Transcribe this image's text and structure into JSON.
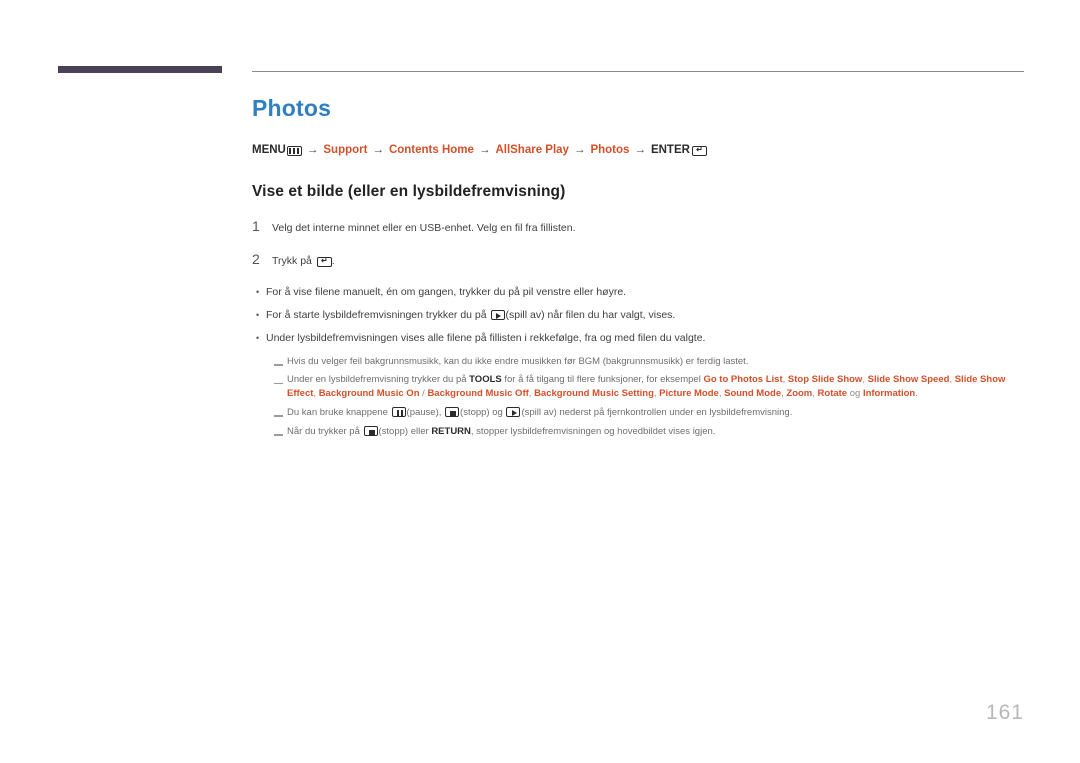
{
  "page": {
    "number": "161"
  },
  "title": "Photos",
  "breadcrumb": {
    "menu_label": "MENU",
    "menu_icon": "menu-grid-icon",
    "arrow": "→",
    "items": [
      {
        "label": "Support",
        "accent": true
      },
      {
        "label": "Contents Home",
        "accent": true
      },
      {
        "label": "AllShare Play",
        "accent": true
      },
      {
        "label": "Photos",
        "accent": true
      }
    ],
    "enter_label": "ENTER",
    "enter_icon": "enter-return-icon"
  },
  "section": {
    "heading": "Vise et bilde (eller en lysbildefremvisning)"
  },
  "steps": [
    {
      "num": "1",
      "text": "Velg det interne minnet eller en USB-enhet. Velg en fil fra fillisten."
    },
    {
      "num": "2",
      "text_before": "Trykk på ",
      "icon": "enter-return-icon",
      "text_after": "."
    }
  ],
  "bullets": [
    {
      "marker": "•",
      "text": "For å vise filene manuelt, én om gangen, trykker du på pil venstre eller høyre."
    },
    {
      "marker": "•",
      "text_before": "For å starte lysbildefremvisningen trykker du på ",
      "icon": "play-button-icon",
      "text_after": "(spill av) når filen du har valgt, vises."
    },
    {
      "marker": "•",
      "text": "Under lysbildefremvisningen vises alle filene på fillisten i rekkefølge, fra og med filen du valgte."
    }
  ],
  "notes": [
    {
      "text": "Hvis du velger feil bakgrunnsmusikk, kan du ikke endre musikken før BGM (bakgrunnsmusikk) er ferdig lastet."
    },
    {
      "part1": "Under en lysbildefremvisning trykker du på ",
      "bold1": "TOOLS",
      "part2": " for å få tilgang til flere funksjoner, for eksempel ",
      "options": [
        "Go to Photos List",
        "Stop Slide Show",
        "Slide Show Speed",
        "Slide Show Effect",
        "Background Music On",
        "Background Music Off",
        "Background Music Setting",
        "Picture Mode",
        "Sound Mode",
        "Zoom",
        "Rotate",
        "Information"
      ],
      "separator_slash": " / ",
      "separator_comma": ", ",
      "conjunction": " og ",
      "terminator": "."
    },
    {
      "part1": "Du kan bruke knappene ",
      "icon1": "pause-button-icon",
      "part2": "(pause), ",
      "icon2": "stop-button-icon",
      "part3": "(stopp) og ",
      "icon3": "play-button-icon",
      "part4": "(spill av) nederst på fjernkontrollen under en lysbildefremvisning."
    },
    {
      "part1": "Når du trykker på ",
      "icon1": "stop-button-icon",
      "part2": "(stopp) eller ",
      "bold1": "RETURN",
      "part3": ", stopper lysbildefremvisningen og hovedbildet vises igjen."
    }
  ],
  "colors": {
    "title_blue": "#2f7fc1",
    "accent_orange": "#d4502a",
    "header_bar": "#4a4156",
    "page_number": "#b8b8b8"
  }
}
